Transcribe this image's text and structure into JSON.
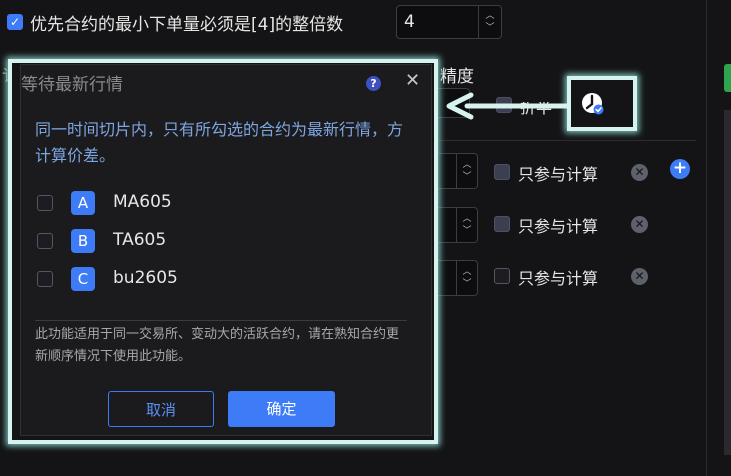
{
  "top_option": {
    "checked": true,
    "label": "优先合约的最小下单量必须是[4]的整倍数",
    "value": "4"
  },
  "bg_labels": {
    "precision": "精度",
    "partial_left": "讠",
    "partial_discount": "折半"
  },
  "rows": [
    {
      "calc_label": "只参与计算"
    },
    {
      "calc_label": "只参与计算"
    },
    {
      "calc_label": "只参与计算"
    }
  ],
  "dialog": {
    "title": "等待最新行情",
    "help_icon": "?",
    "close_icon": "✕",
    "description": "同一时间切片内，只有所勾选的合约为最新行情，方计算价差。",
    "contracts": [
      {
        "tag": "A",
        "name": "MA605",
        "checked": false
      },
      {
        "tag": "B",
        "name": "TA605",
        "checked": false
      },
      {
        "tag": "C",
        "name": "bu2605",
        "checked": false
      }
    ],
    "note": "此功能适用于同一交易所、变动大的活跃合约，请在熟知合约更新顺序情况下使用此功能。",
    "cancel_label": "取消",
    "confirm_label": "确定"
  },
  "colors": {
    "accent": "#3d7bf7",
    "highlight": "#d6f3ef",
    "description": "#7ea5e0"
  }
}
